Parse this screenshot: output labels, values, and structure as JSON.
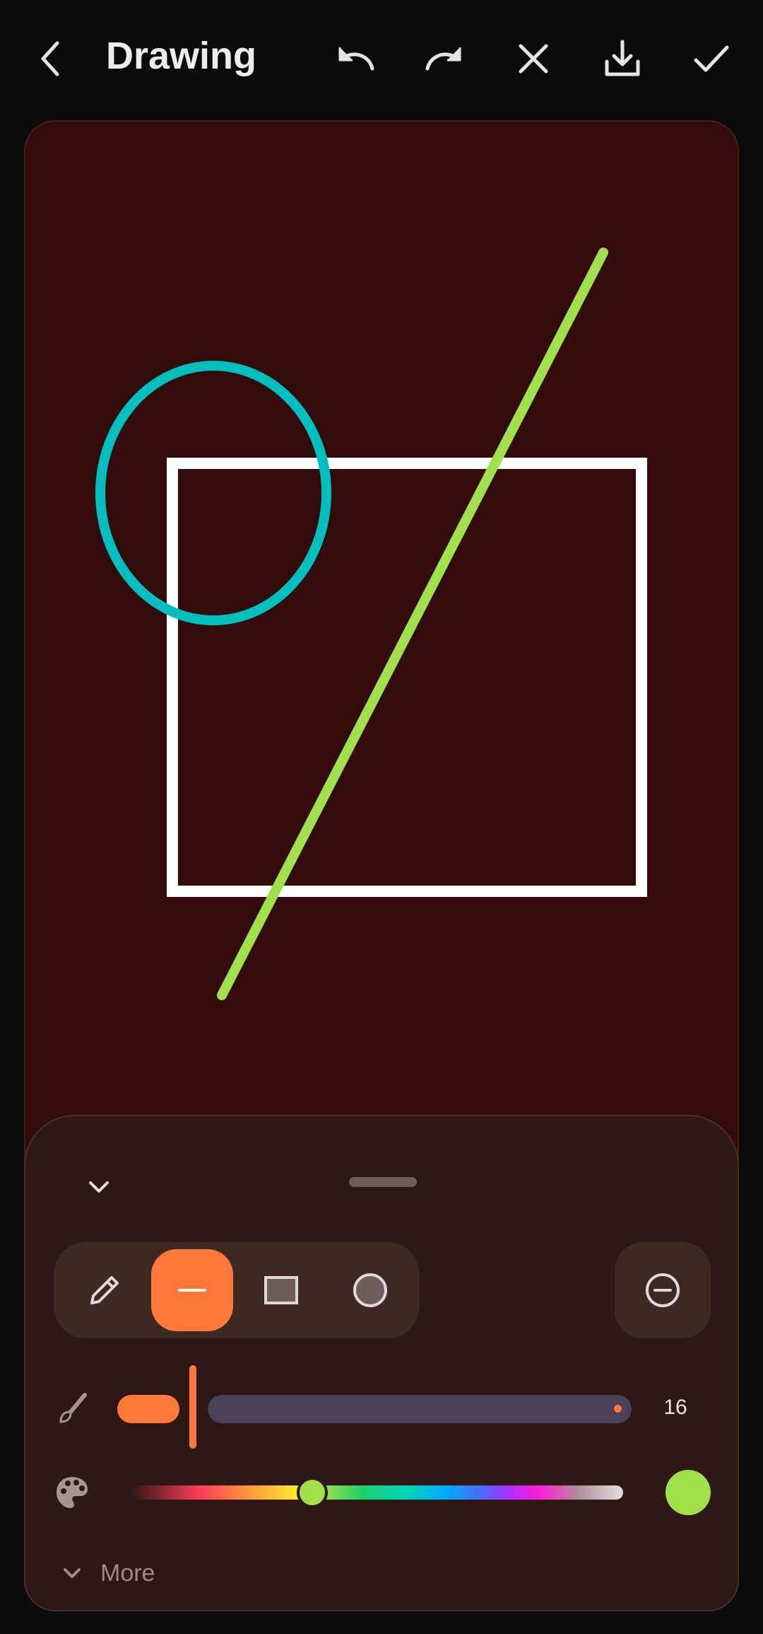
{
  "header": {
    "title": "Drawing",
    "icons": [
      "back-arrow-icon",
      "undo-icon",
      "redo-icon",
      "close-icon",
      "download-icon",
      "check-icon"
    ]
  },
  "canvas": {
    "background": "#340b0b",
    "shapes": [
      {
        "type": "rectangle",
        "stroke": "#ffffff"
      },
      {
        "type": "ellipse",
        "stroke": "#00bfbf"
      },
      {
        "type": "line",
        "stroke": "#9fe04b"
      }
    ]
  },
  "panel": {
    "tools": [
      {
        "name": "pencil",
        "icon": "pencil-icon",
        "active": false
      },
      {
        "name": "line",
        "icon": "line-icon",
        "active": true
      },
      {
        "name": "rectangle",
        "icon": "rectangle-icon",
        "active": false
      },
      {
        "name": "circle",
        "icon": "circle-icon",
        "active": false
      }
    ],
    "eraser_icon": "eraser-icon",
    "brush_size": "16",
    "brush_size_fraction": 0.1,
    "active_color": "#9fe04b",
    "accent_color": "#ff7a3a",
    "hue_position": 0.36,
    "more_label": "More"
  }
}
